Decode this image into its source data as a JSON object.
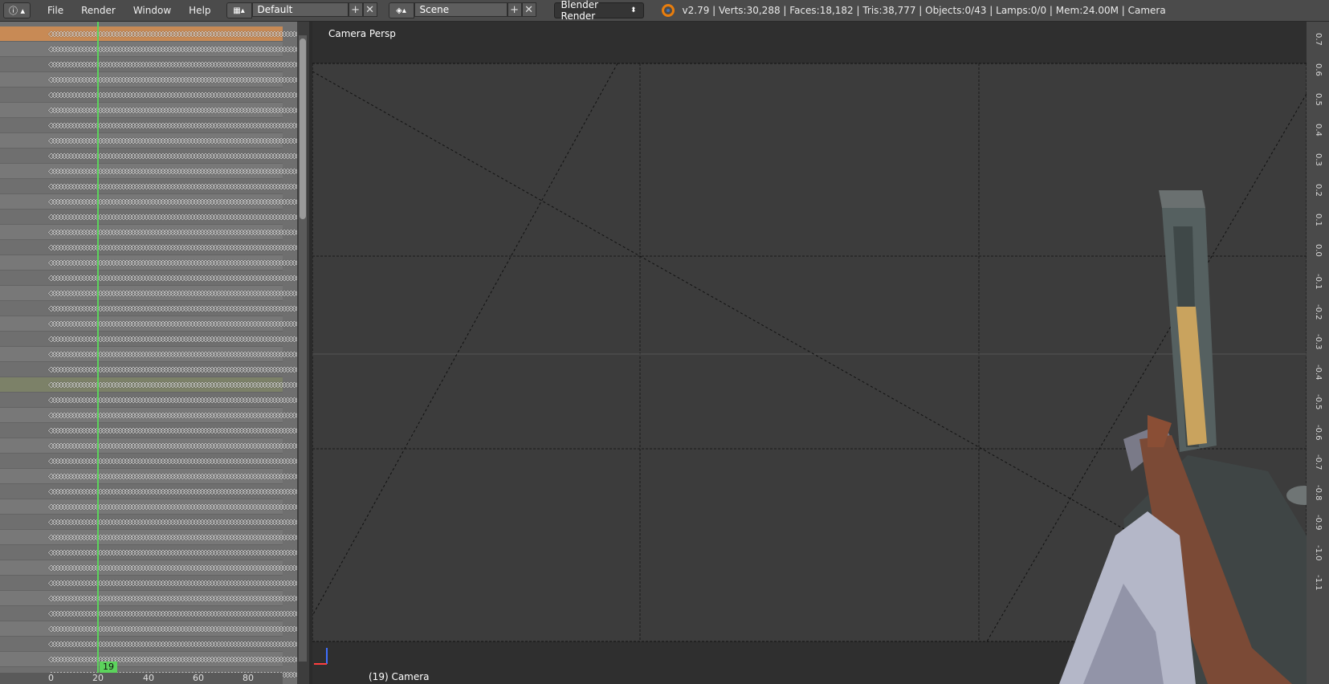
{
  "topbar": {
    "menu": [
      "File",
      "Render",
      "Window",
      "Help"
    ],
    "layout_name": "Default",
    "scene_name": "Scene",
    "render_engine": "Blender Render",
    "stats": "v2.79 | Verts:30,288 | Faces:18,182 | Tris:38,777 | Objects:0/43 | Lamps:0/0 | Mem:24.00M | Camera"
  },
  "dopesheet": {
    "current_frame": "19",
    "ruler_ticks": [
      "0",
      "20",
      "40",
      "60",
      "80"
    ],
    "keyframe_row": "◇◇◇◇◇◇◇◇◇◇◇◇◇◇◇◇◇◇◇◇◇◇◇◇◇◇◇◇◇◇◇◇◇◇◇◇◇◇◇◇◇◇◇◇◇◇◇◇◇◇◇◇◇◇◇◇◇◇◇◇◇◇◇◇◇◇◇◇◇◇◇◇◇◇◇◇◇◇◇◇◇◇◇"
  },
  "viewport": {
    "view_name": "Camera Persp",
    "footer_label": "(19) Camera"
  },
  "side_ruler": [
    "0.7",
    "0.6",
    "0.5",
    "0.4",
    "0.3",
    "0.2",
    "0.1",
    "0.0",
    "-0.1",
    "-0.2",
    "-0.3",
    "-0.4",
    "-0.5",
    "-0.6",
    "-0.7",
    "-0.8",
    "-0.9",
    "-1.0",
    "-1.1"
  ]
}
